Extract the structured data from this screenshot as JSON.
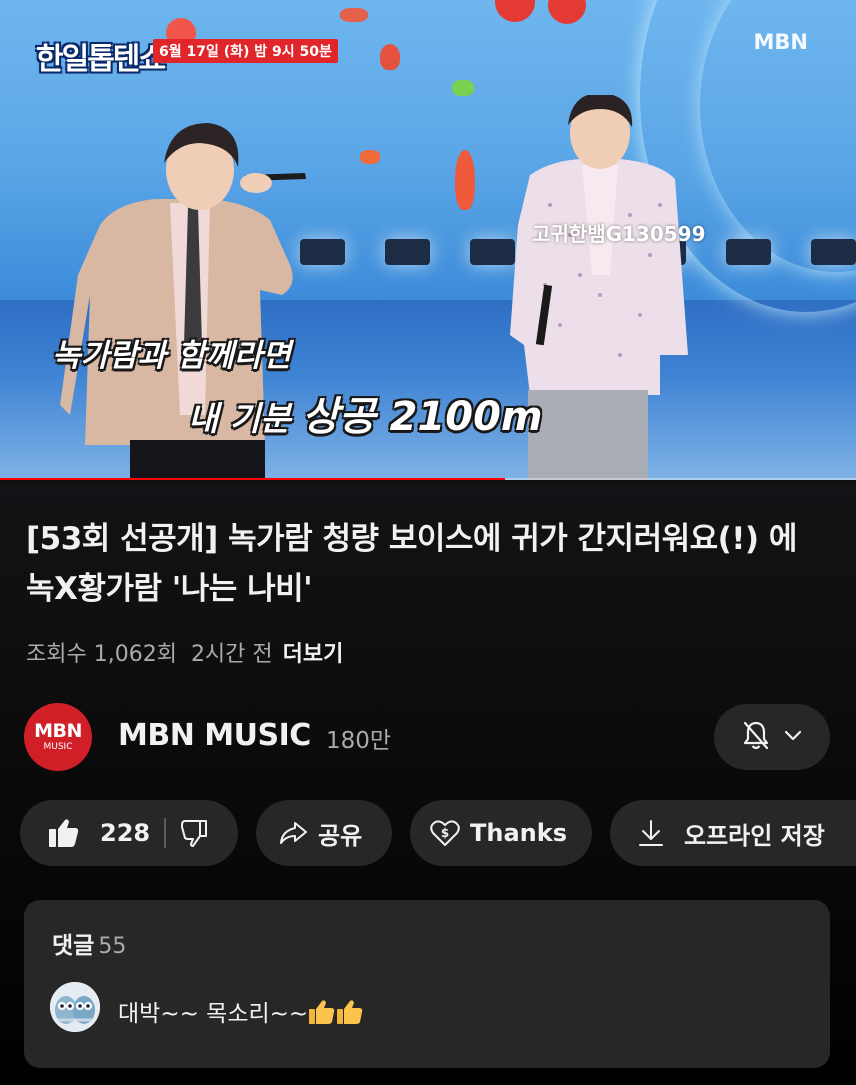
{
  "video": {
    "show_logo": "한일톱텐쇼",
    "air_time": "6월 17일 (화) 밤 9시 50분",
    "broadcaster_watermark": "MBN",
    "user_watermark": "고귀한뱀G130599",
    "caption_line1": "녹가람과 함께라면",
    "caption_line2_prefix": "내 기분 ",
    "caption_line2_emph": "상공 2100m",
    "progress": 0.59
  },
  "info": {
    "title": "[53회 선공개] 녹가람 청량 보이스에 귀가 간지러워요(!) 에녹X황가람 '나는 나비'",
    "views": "조회수 1,062회",
    "time_ago": "2시간 전",
    "more": "더보기"
  },
  "channel": {
    "avatar_top": "MBN",
    "avatar_bottom": "MUSIC",
    "name": "MBN MUSIC",
    "subscribers": "180만"
  },
  "actions": {
    "likes": "228",
    "share": "공유",
    "thanks": "Thanks",
    "download": "오프라인 저장"
  },
  "comments": {
    "header": "댓글",
    "count": "55",
    "top_comment": "대박~~ 목소리~~"
  },
  "colors": {
    "background": "#0f0f0f",
    "pill": "#272727",
    "accent_red": "#ff0000",
    "secondary_text": "#aaaaaa"
  }
}
